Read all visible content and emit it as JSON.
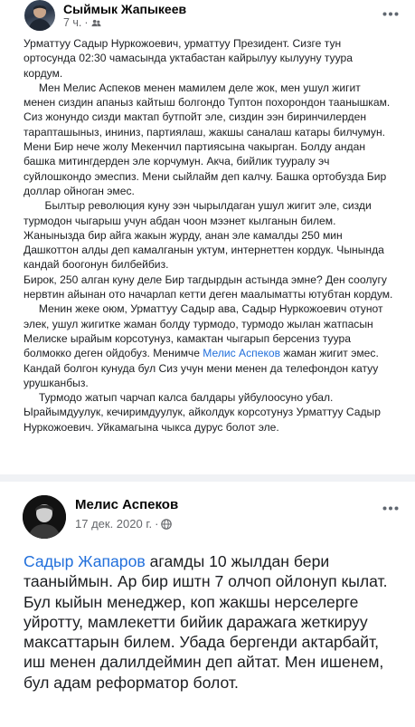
{
  "post1": {
    "author": "Сыймык Жапыкеев",
    "time": "7 ч.",
    "more_icon": "ellipsis-icon",
    "p1": "Урматтуу Садыр Нуркожоевич,  урматтуу Президент. Сизге тун ортосунда 02:30 чамасында уктабастан кайрылуу кылууну туура кордум.",
    "p2": "     Мен Мелис Аспеков менен мамилем деле жок, мен ушул жигит менен сиздин апаныз кайтыш болгондо Туптон похорондон таанышкам. Сиз жонундо сизди мактап бутпойт эле, сиздин ээн биринчилерден тарапташыныз, ининиз, партиялаш, жакшы саналаш катары билчумун. Мени Бир нече жолу Мекенчил партиясына чакырган. Болду андан башка митингдерден эле корчумун. Акча, бийлик тууралу эч суйлошкондо эмеспиз. Мени сыйлайм деп калчу. Башка ортобузда Бир доллар ойноган эмес.",
    "p3": "       Былтыр революция куну ээн чырылдаган ушул жигит эле, сизди турмодон чыгарыш учун абдан чоон мээнет кылганын билем. Жаныныздa бир айга жакын журду, анан эле камалды 250 мин Дашкоттон алды деп камалганын уктум, интернеттен кордук. Чынында кандай боогонун билбейбиз.",
    "p4": "Бирок, 250 алган куну деле Бир тагдырдын астында эмне? Ден соолугу нервтин айынан ото начарлап кетти деген маалыматты ютубтан кордум.",
    "p5_start": "     Менин жеке оюм, Урматтуу Садыр ава, Садыр Нуркожоевич отунот элек, ушул жигитке жаман болду турмодо, турмодо жылан жатпасын Мелиске ырайым корсотунуз, камактан чыгарып берсениз туура болмокко деген ойдобуз. Менимче ",
    "p5_link": "Мелис Аспеков",
    "p5_end": " жаман жигит эмес. Кандай болгон кунуда бул Сиз учун мени менен да телефондон катуу урушканбыз.",
    "p6": "     Турмодо жатып чарчап калса балдары уйбулоосуно убал. Ырайымдуулук, кечиримдуулук, айколдук корсотунуз Урматтуу Садыр Нуркожоевич. Уйкамагына чыкса дурус болот эле."
  },
  "post2": {
    "author": "Мелис Аспеков",
    "date": "17 дек. 2020 г.",
    "privacy_icon": "globe-icon",
    "more_icon": "ellipsis-icon",
    "link": "Садыр Жапаров",
    "text": " агамды 10 жылдан бери тааныймын. Ар бир иштн 7 олчоп ойлонуп кылат. Бул кыйын менеджер, коп жакшы нерселерге уйротту, мамлекетти бийик даражага жеткируу максаттарын билем. Убада бергенди актарбайт, иш менен далилдеймин деп айтат. Мен ишенем, бул адам реформатор болот."
  },
  "colors": {
    "link": "#216fdb",
    "meta": "#65676b",
    "background": "#f0f2f5"
  }
}
